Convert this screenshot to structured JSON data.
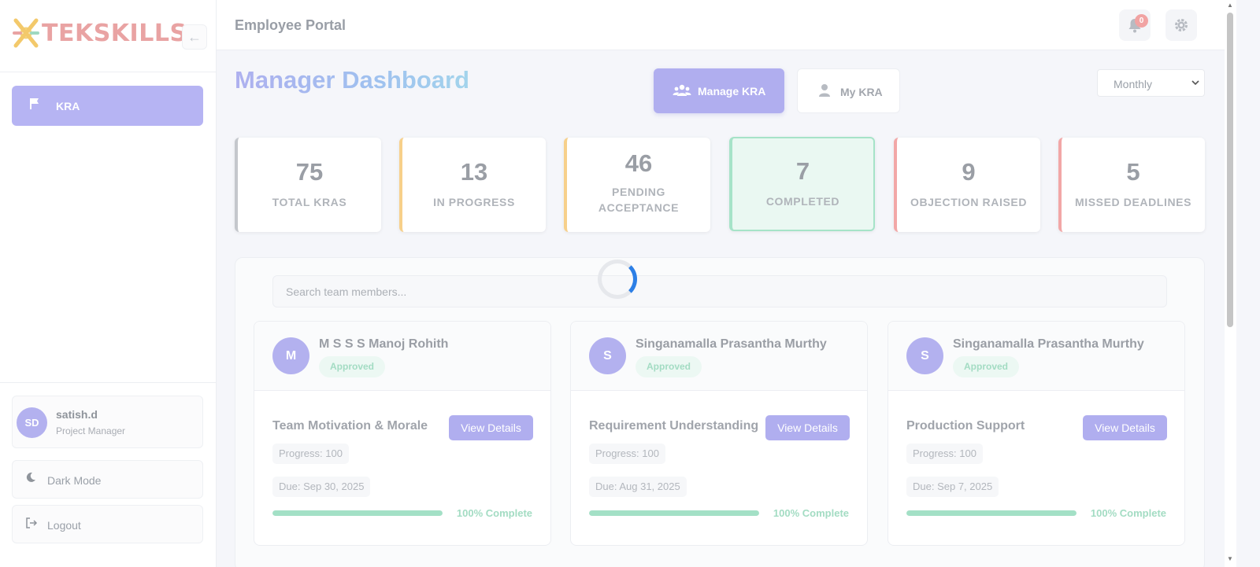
{
  "brand": {
    "name": "TEKSKILLS",
    "logo_icon": "tekskills-logo"
  },
  "sidebar": {
    "collapse_icon": "arrow-left-icon",
    "nav": [
      {
        "label": "KRA",
        "icon": "flag-icon",
        "active": true
      }
    ],
    "user": {
      "initials": "SD",
      "name": "satish.d",
      "role": "Project Manager"
    },
    "dark_mode_label": "Dark Mode",
    "logout_label": "Logout"
  },
  "header": {
    "title": "Employee Portal",
    "notifications_count": "0"
  },
  "main": {
    "title": "Manager Dashboard",
    "manage_kra_label": "Manage KRA",
    "my_kra_label": "My KRA",
    "period": "Monthly",
    "stats": [
      {
        "value": "75",
        "label": "TOTAL KRAS",
        "color": "#c4c7cc"
      },
      {
        "value": "13",
        "label": "IN PROGRESS",
        "color": "#f7d08a"
      },
      {
        "value": "46",
        "label": "PENDING ACCEPTANCE",
        "color": "#f7d08a"
      },
      {
        "value": "7",
        "label": "COMPLETED",
        "color": "#a6e3c8"
      },
      {
        "value": "9",
        "label": "OBJECTION RAISED",
        "color": "#f2a7a7"
      },
      {
        "value": "5",
        "label": "MISSED DEADLINES",
        "color": "#f2a7a7"
      }
    ],
    "search_placeholder": "Search team members...",
    "members": [
      {
        "initial": "M",
        "name": "M S S S Manoj Rohith",
        "status": "Approved",
        "kra": "Team Motivation & Morale",
        "view_label": "View Details",
        "progress_text": "Progress: 100",
        "due": "Due: Sep 30, 2025",
        "progress": 1.0,
        "complete_text": "100% Complete"
      },
      {
        "initial": "S",
        "name": "Singanamalla Prasantha Murthy",
        "status": "Approved",
        "kra": "Requirement Understanding",
        "view_label": "View Details",
        "progress_text": "Progress: 100",
        "due": "Due: Aug 31, 2025",
        "progress": 1.0,
        "complete_text": "100% Complete"
      },
      {
        "initial": "S",
        "name": "Singanamalla Prasantha Murthy",
        "status": "Approved",
        "kra": "Production Support",
        "view_label": "View Details",
        "progress_text": "Progress: 100",
        "due": "Due: Sep 7, 2025",
        "progress": 1.0,
        "complete_text": "100% Complete"
      }
    ]
  }
}
